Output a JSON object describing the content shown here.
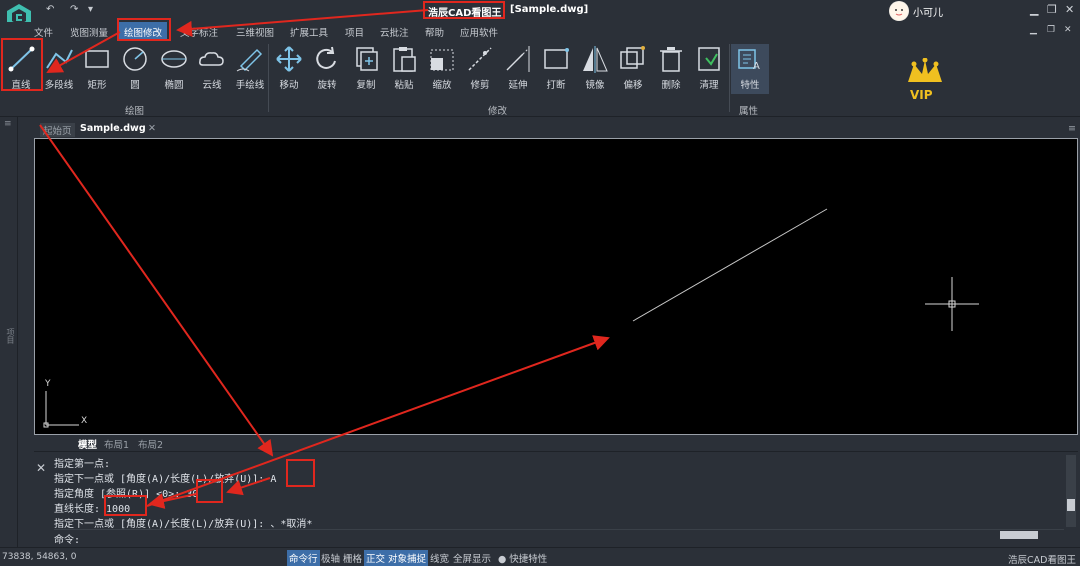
{
  "titlebar": {
    "app_name": "浩辰CAD看图王",
    "file": "[Sample.dwg]",
    "user": "小可儿",
    "quick_access": [
      "↶",
      "↷",
      "▾"
    ]
  },
  "menu": {
    "items": [
      "文件",
      "览图测量",
      "绘图修改",
      "文字标注",
      "三维视图",
      "扩展工具",
      "项目",
      "云批注",
      "帮助",
      "应用软件"
    ],
    "active": "绘图修改"
  },
  "ribbon": {
    "draw_tools": [
      "直线",
      "多段线",
      "矩形",
      "圆",
      "椭圆",
      "云线",
      "手绘线"
    ],
    "modify_tools": [
      "移动",
      "旋转",
      "复制",
      "粘贴",
      "缩放",
      "修剪",
      "延伸",
      "打断",
      "镜像",
      "偏移",
      "删除",
      "清理"
    ],
    "prop_tools": [
      "特性"
    ],
    "groups": {
      "draw": "绘图",
      "modify": "修改",
      "props": "属性"
    },
    "vip": "VIP"
  },
  "side_panel": {
    "label": "项目"
  },
  "tabs": {
    "start": "起始页",
    "file": "Sample.dwg",
    "close": "✕"
  },
  "layout_tabs": [
    "模型",
    "布局1",
    "布局2"
  ],
  "ucs": {
    "x": "X",
    "y": "Y"
  },
  "command": {
    "lines": [
      "指定第一点:",
      "指定下一点或 [角度(A)/长度(L)/放弃(U)]: A",
      "指定角度 [参照(R)] <0>: 30",
      "直线长度: 1000",
      "指定下一点或 [角度(A)/长度(L)/放弃(U)]: 、*取消*"
    ],
    "prompt": "命令:"
  },
  "status": {
    "coords": "73838, 54863, 0",
    "buttons": [
      "命令行",
      "极轴",
      "栅格",
      "正交",
      "对象捕捉",
      "线宽",
      "全屏显示",
      "● 快捷特性"
    ],
    "on": [
      "命令行",
      "正交",
      "对象捕捉"
    ],
    "app": "浩辰CAD看图王"
  },
  "colors": {
    "accent": "#3d6ea8",
    "annotation": "#e0271e",
    "canvas": "#000000",
    "panel": "#2b3038"
  }
}
